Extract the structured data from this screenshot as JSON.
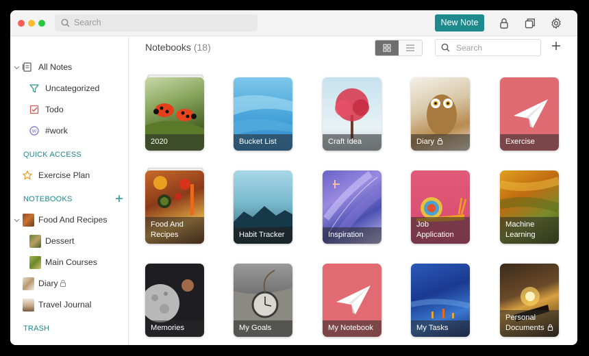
{
  "topbar": {
    "search_placeholder": "Search",
    "new_note_label": "New Note",
    "icons": [
      "lock-icon",
      "windows-icon",
      "gear-icon"
    ]
  },
  "sidebar": {
    "all_notes": "All Notes",
    "items": [
      {
        "label": "Uncategorized",
        "icon": "funnel-icon"
      },
      {
        "label": "Todo",
        "icon": "checkbox-icon"
      },
      {
        "label": "#work",
        "icon": "tag-icon"
      }
    ],
    "quick_access_header": "QUICK ACCESS",
    "quick_access": [
      {
        "label": "Exercise Plan",
        "icon": "star-icon"
      }
    ],
    "notebooks_header": "NOTEBOOKS",
    "notebooks": [
      {
        "label": "Food And Recipes"
      },
      {
        "label": "Dessert"
      },
      {
        "label": "Main Courses"
      },
      {
        "label": "Diary"
      },
      {
        "label": "Travel Journal"
      }
    ],
    "trash_header": "TRASH"
  },
  "main": {
    "title": "Notebooks",
    "count": "(18)",
    "search_placeholder": "Search",
    "notebooks": [
      {
        "name": "2020",
        "locked": false
      },
      {
        "name": "Bucket List",
        "locked": false
      },
      {
        "name": "Craft Idea",
        "locked": false
      },
      {
        "name": "Diary",
        "locked": true
      },
      {
        "name": "Exercise",
        "locked": false
      },
      {
        "name": "Food And Recipes",
        "locked": false
      },
      {
        "name": "Habit Tracker",
        "locked": false
      },
      {
        "name": "Inspiration",
        "locked": false
      },
      {
        "name": "Job Application",
        "locked": false
      },
      {
        "name": "Machine Learning",
        "locked": false
      },
      {
        "name": "Memories",
        "locked": false
      },
      {
        "name": "My Goals",
        "locked": false
      },
      {
        "name": "My Notebook",
        "locked": false
      },
      {
        "name": "My Tasks",
        "locked": false
      },
      {
        "name": "Personal Documents",
        "locked": true
      }
    ]
  },
  "colors": {
    "accent": "#1e8a8d",
    "sidebar_header": "#1a8a8e"
  }
}
